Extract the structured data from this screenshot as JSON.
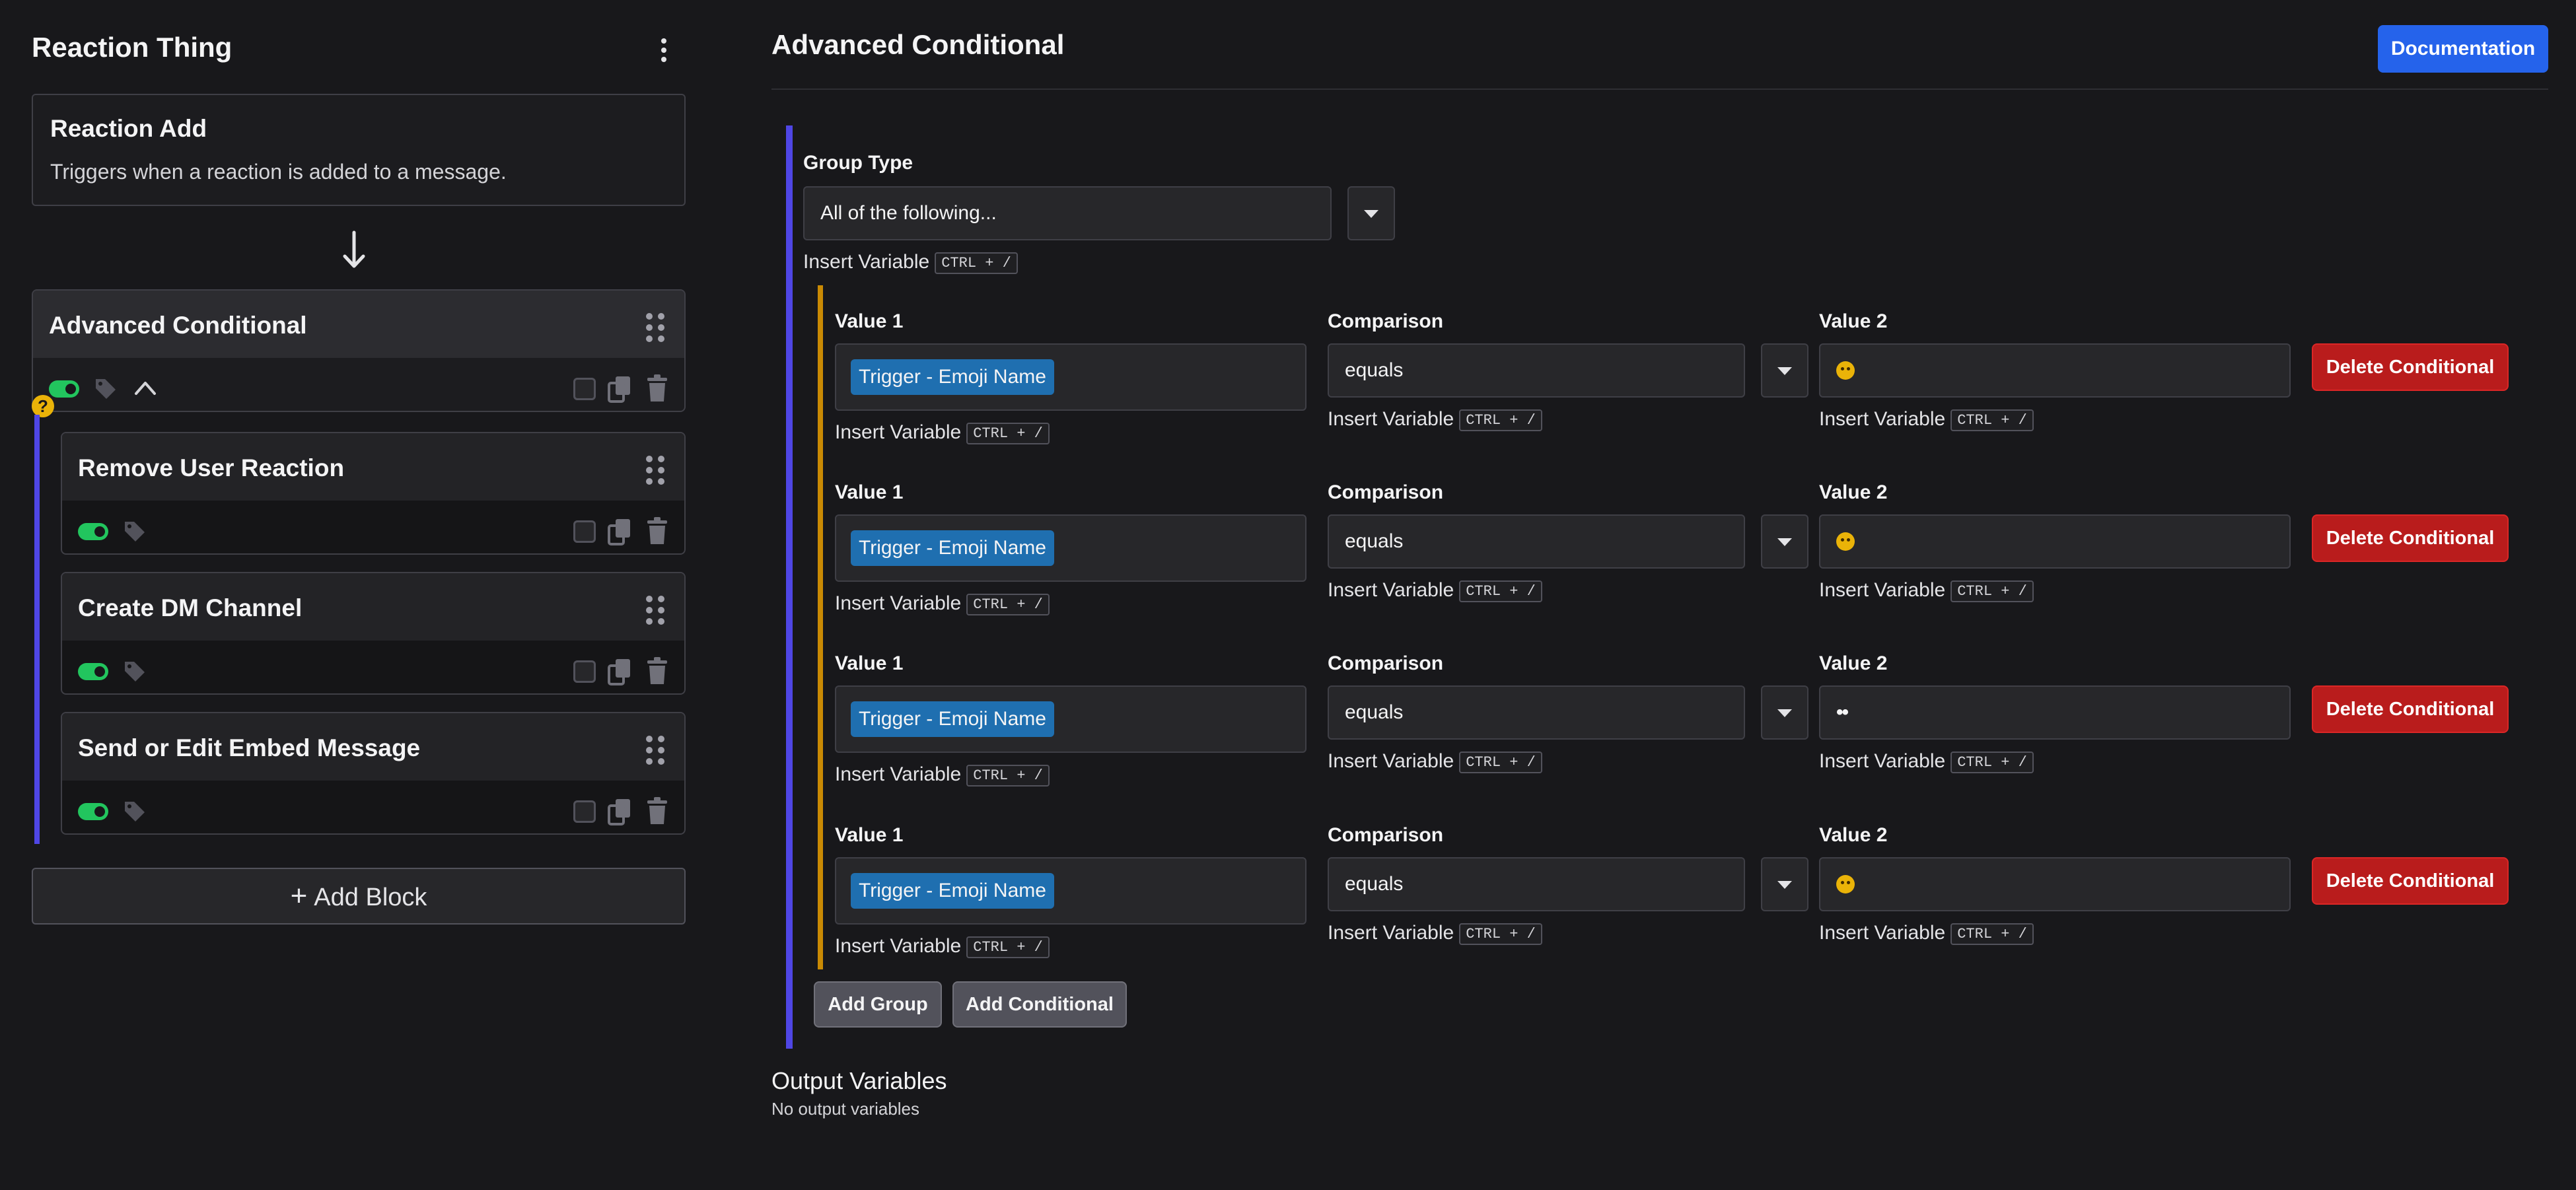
{
  "sidebar": {
    "title": "Reaction Thing",
    "trigger": {
      "title": "Reaction Add",
      "description": "Triggers when a reaction is added to a message."
    },
    "blocks": [
      {
        "name": "Advanced Conditional",
        "enabled": true
      },
      {
        "name": "Remove User Reaction",
        "enabled": true
      },
      {
        "name": "Create DM Channel",
        "enabled": true
      },
      {
        "name": "Send or Edit Embed Message",
        "enabled": true
      }
    ],
    "help_badge": "?",
    "add_block_label": "Add Block"
  },
  "main": {
    "title": "Advanced Conditional",
    "documentation_label": "Documentation",
    "group_type_label": "Group Type",
    "group_type_value": "All of the following...",
    "insert_variable_label": "Insert Variable",
    "insert_variable_shortcut": "CTRL + /",
    "value1_label": "Value 1",
    "comparison_label": "Comparison",
    "value2_label": "Value 2",
    "delete_label": "Delete Conditional",
    "conditions": [
      {
        "value1": "Trigger - Emoji Name",
        "comparison": "equals",
        "value2_icon": "grinning-squint-emoji-icon"
      },
      {
        "value1": "Trigger - Emoji Name",
        "comparison": "equals",
        "value2_icon": "smiling-emoji-icon"
      },
      {
        "value1": "Trigger - Emoji Name",
        "comparison": "equals",
        "value2_icon": "eyes-emoji-icon"
      },
      {
        "value1": "Trigger - Emoji Name",
        "comparison": "equals",
        "value2_icon": "slightly-smiling-emoji-icon"
      }
    ],
    "add_group_label": "Add Group",
    "add_conditional_label": "Add Conditional",
    "output_title": "Output Variables",
    "output_empty": "No output variables"
  },
  "colors": {
    "background": "#18181b",
    "accent_blue": "#2563eb",
    "danger_red": "#b91c1c",
    "toggle_green": "#22c55e",
    "group_line": "#4f46e5",
    "inner_group_line": "#ca8a04",
    "variable_chip": "#1f6fb0"
  }
}
